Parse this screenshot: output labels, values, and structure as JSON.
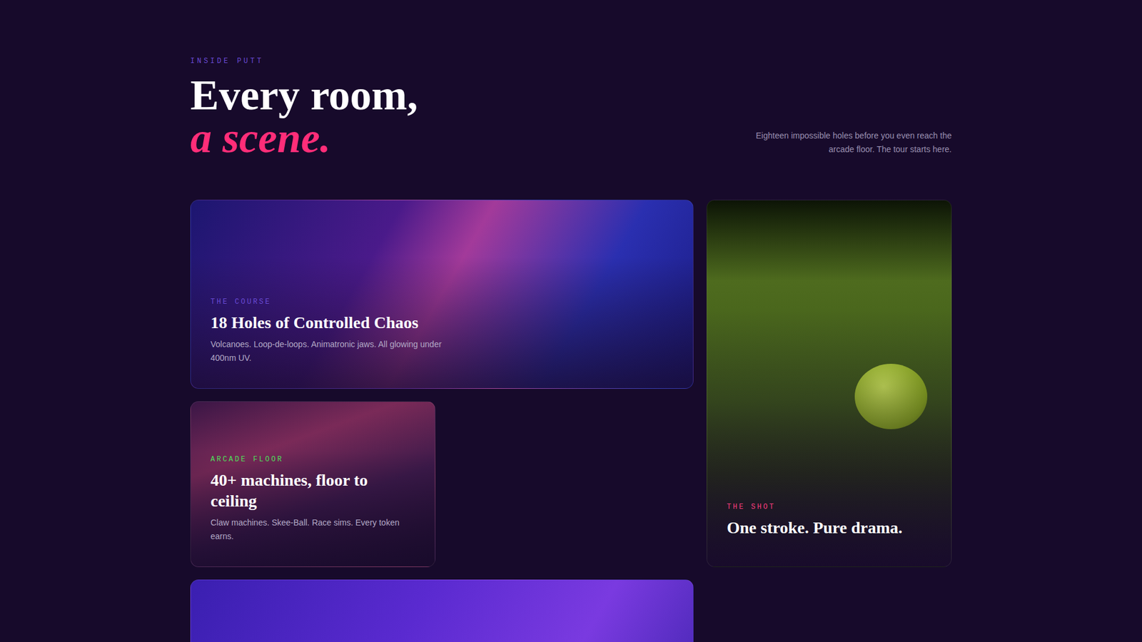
{
  "header": {
    "eyebrow": "INSIDE PUTT",
    "title_line": "Every room,",
    "title_accent": "a scene.",
    "intro": "Eighteen impossible holes before you even reach the arcade floor. The tour starts here."
  },
  "cards": [
    {
      "label": "THE COURSE",
      "title": "18 Holes of Controlled Chaos",
      "description": "Volcanoes. Loop-de-loops. Animatronic jaws. All glowing under 400nm UV.",
      "color": "#6a4bd6",
      "kind": "wide"
    },
    {
      "label": "THE SHOT",
      "title": "One stroke. Pure drama.",
      "color": "#ff3d7f",
      "kind": "tall"
    },
    {
      "label": "ARCADE FLOOR",
      "title": "40+ machines, floor to ceiling",
      "description": "Claw machines. Skee-Ball. Race sims. Every token earns.",
      "color": "#4ee05a",
      "kind": "small"
    },
    {
      "kind": "wide"
    }
  ]
}
